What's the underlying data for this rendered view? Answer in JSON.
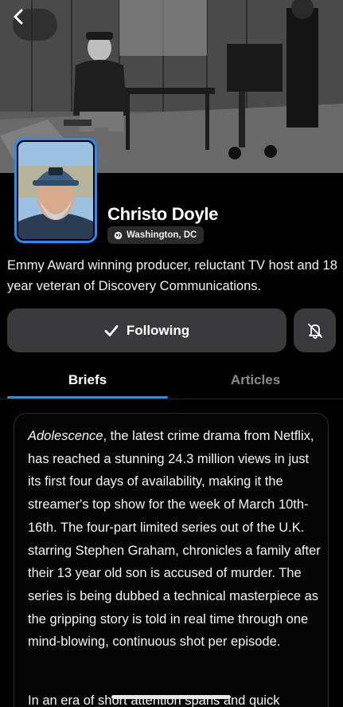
{
  "profile": {
    "name": "Christo Doyle",
    "location": "Washington, DC",
    "bio": "Emmy Award winning producer, reluctant TV host and 18 year veteran of Discovery Communications."
  },
  "actions": {
    "following_label": "Following"
  },
  "tabs": [
    {
      "label": "Briefs",
      "active": true
    },
    {
      "label": "Articles",
      "active": false
    }
  ],
  "brief": {
    "title_italic": "Adolescence",
    "paragraph1_rest": ", the latest crime drama from Netflix, has reached a stunning 24.3 million views in just its first four days of availability, making it the streamer's top show for the week of March 10th-16th. The four-part limited series out of the U.K. starring Stephen Graham, chronicles a family after their 13 year old son is accused of murder. The series is being dubbed a technical masterpiece as the gripping story is told in real time through one mind-blowing, continuous shot per episode.",
    "paragraph2_start": "In an era of short attention spans and quick"
  },
  "colors": {
    "accent": "#1e8fff",
    "button_bg": "#3a3a3c",
    "background": "#000000"
  }
}
